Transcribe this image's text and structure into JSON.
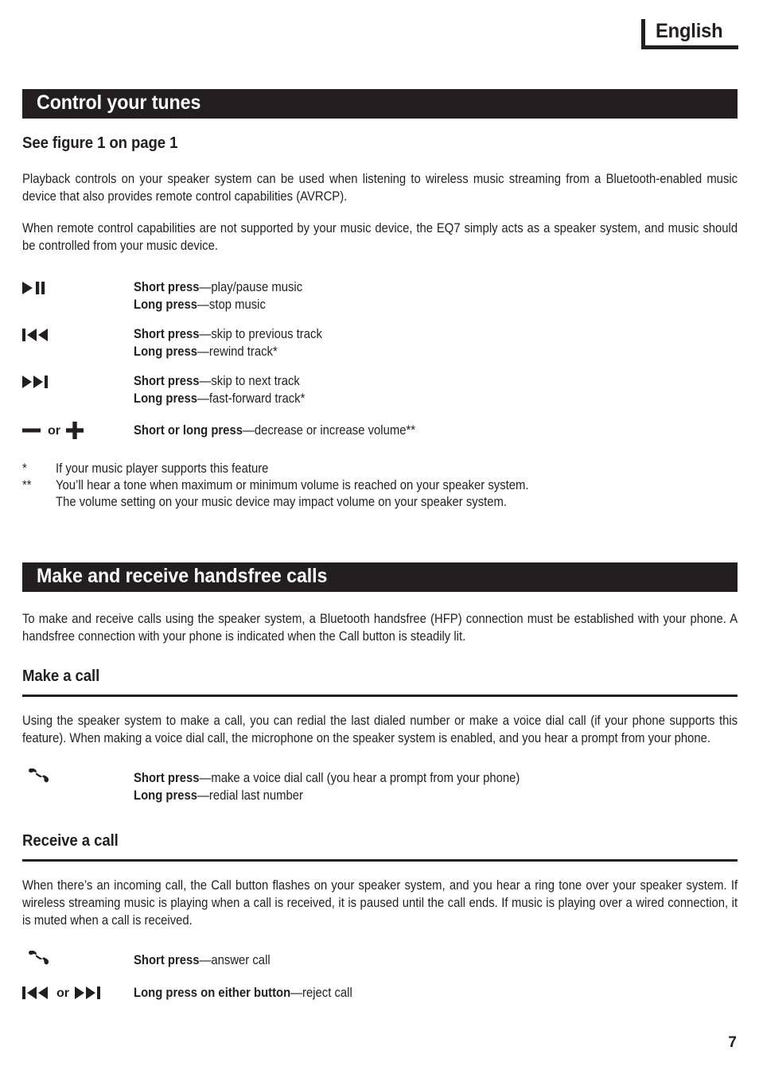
{
  "language_header": {
    "label": "English"
  },
  "sections": [
    {
      "id": "control-your-tunes",
      "title": "Control your tunes",
      "subheading": "See figure 1 on page 1",
      "paragraphs": [
        "Playback controls on your speaker system can be used when listening to wireless music streaming from a Bluetooth-enabled music device that also provides remote control capabilities (AVRCP).",
        "When remote control capabilities are not supported by your music device, the EQ7 simply acts as a speaker system, and music should be controlled from your music device."
      ],
      "controls": [
        {
          "icon": "play-pause-icon",
          "lines": [
            {
              "bold": "Short press",
              "rest": "—play/pause music"
            },
            {
              "bold": "Long press",
              "rest": "—stop music"
            }
          ]
        },
        {
          "icon": "previous-track-icon",
          "lines": [
            {
              "bold": "Short press",
              "rest": "—skip to previous track"
            },
            {
              "bold": "Long press",
              "rest": "—rewind track*"
            }
          ]
        },
        {
          "icon": "next-track-icon",
          "lines": [
            {
              "bold": "Short press",
              "rest": "—skip to next track"
            },
            {
              "bold": "Long press",
              "rest": "—fast-forward track*"
            }
          ]
        },
        {
          "icon": "volume-down-up-icon",
          "or_label": "or",
          "lines": [
            {
              "bold": "Short or long press",
              "rest": "—decrease or increase volume**"
            }
          ]
        }
      ],
      "footnotes": [
        {
          "mark": "*",
          "lines": [
            "If your music player supports this feature"
          ]
        },
        {
          "mark": "**",
          "lines": [
            "You’ll hear a tone when maximum or minimum volume is reached on your speaker system.",
            "The volume setting on your music device may impact volume on your speaker system."
          ]
        }
      ]
    },
    {
      "id": "make-and-receive-handsfree-calls",
      "title": "Make and receive handsfree calls",
      "intro": "To make and receive calls using the speaker system, a Bluetooth handsfree (HFP) connection must be established with your phone. A handsfree connection with your phone is indicated when the Call button is steadily lit.",
      "subsections": [
        {
          "id": "make-a-call",
          "heading": "Make a call",
          "paragraph": "Using the speaker system to make a call, you can redial the last dialed number or make a voice dial call (if your phone supports this feature). When making a voice dial call, the microphone on the speaker system is enabled, and you hear a prompt from your phone.",
          "controls": [
            {
              "icon": "phone-handset-icon",
              "lines": [
                {
                  "bold": "Short press",
                  "rest": "—make a voice dial call (you hear a prompt from your phone)"
                },
                {
                  "bold": "Long press",
                  "rest": "—redial last number"
                }
              ]
            }
          ]
        },
        {
          "id": "receive-a-call",
          "heading": "Receive a call",
          "paragraph": "When there’s an incoming call, the Call button flashes on your speaker system, and you hear a ring tone over your speaker system. If wireless streaming music is playing when a call is received, it is paused until the call ends. If music is playing over a wired connection, it is muted when a call is received.",
          "controls": [
            {
              "icon": "phone-handset-icon",
              "lines": [
                {
                  "bold": "Short press",
                  "rest": "—answer call"
                }
              ]
            },
            {
              "icon": "previous-next-track-icon",
              "or_label": "or",
              "lines": [
                {
                  "bold": "Long press on either button",
                  "rest": "—reject call"
                }
              ]
            }
          ]
        }
      ]
    }
  ],
  "footer": {
    "page_number": "7"
  },
  "colors": {
    "ink": "#231f20",
    "paper": "#ffffff"
  }
}
